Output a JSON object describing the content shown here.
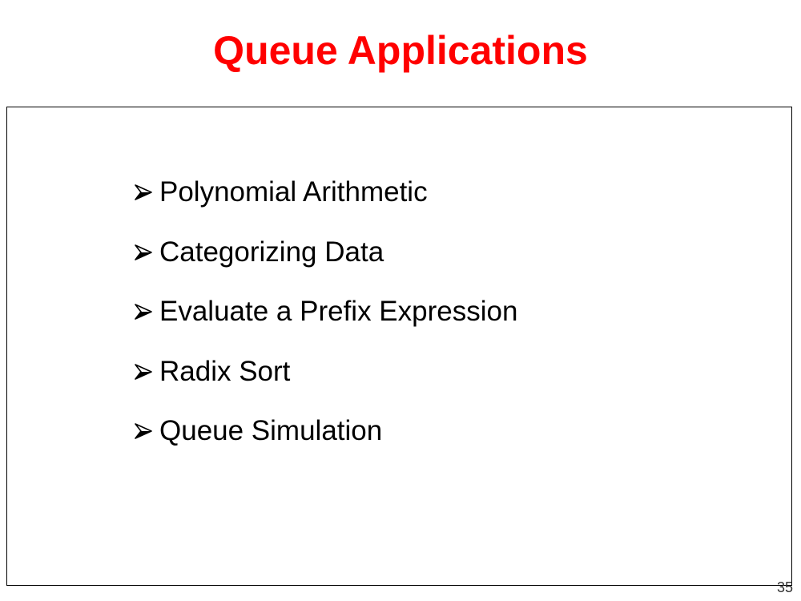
{
  "slide": {
    "title": "Queue Applications",
    "bullets": [
      {
        "label": "Polynomial Arithmetic",
        "icon": "arrow-bullet-icon"
      },
      {
        "label": "Categorizing Data",
        "icon": "arrow-bullet-icon"
      },
      {
        "label": "Evaluate a Prefix Expression",
        "icon": "arrow-bullet-icon"
      },
      {
        "label": "Radix Sort",
        "icon": "arrow-bullet-icon"
      },
      {
        "label": "Queue Simulation",
        "icon": "arrow-bullet-icon"
      }
    ],
    "page_number": "35"
  },
  "colors": {
    "title": "#ff0000",
    "text": "#000000",
    "frame": "#000000"
  }
}
